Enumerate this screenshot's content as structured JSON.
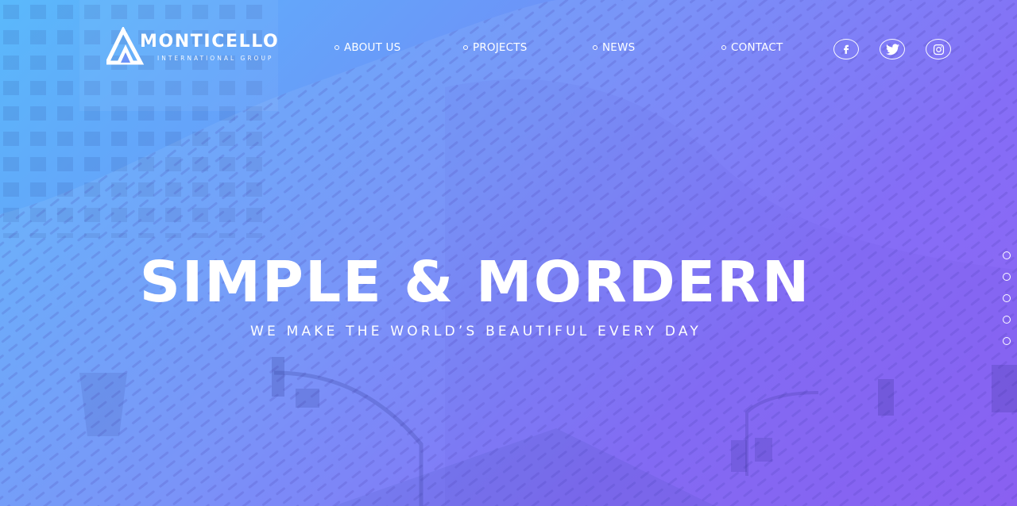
{
  "brand": {
    "name": "MONTICELLO",
    "tagline": "INTERNATIONAL GROUP"
  },
  "nav": {
    "items": [
      {
        "label": "ABOUT US"
      },
      {
        "label": "PROJECTS"
      },
      {
        "label": "NEWS"
      },
      {
        "label": "CONTACT"
      }
    ]
  },
  "social": {
    "items": [
      {
        "icon": "facebook-icon"
      },
      {
        "icon": "twitter-icon"
      },
      {
        "icon": "instagram-icon"
      }
    ]
  },
  "hero": {
    "title": "SIMPLE & MORDERN",
    "subtitle": "WE MAKE THE WORLD’S BEAUTIFUL EVERY DAY"
  },
  "slider": {
    "slide_count": 5
  },
  "colors": {
    "gradient_start": "#5ab9fb",
    "gradient_end": "#8657f4",
    "text": "#ffffff"
  }
}
